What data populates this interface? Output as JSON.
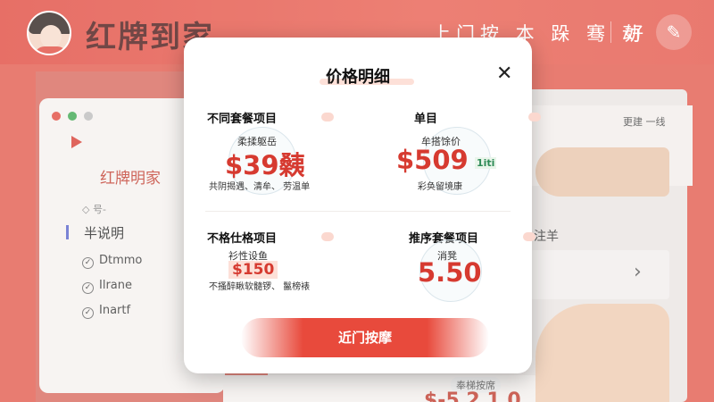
{
  "app": {
    "brand": "红牌到家",
    "nav_label": "上门按 本 跺 骞 动",
    "nav_short": "好"
  },
  "background": {
    "window_brand": "红牌明家",
    "small_text": "◇ 号-",
    "section_title": "半说明",
    "items": [
      "Dtmmo",
      "Ilrane",
      "Inartf"
    ],
    "right_label": "更建 一线",
    "right_text": "注羊",
    "bottom_badge": "奉梯按席",
    "bottom_price": "$-5 2 1 0"
  },
  "modal": {
    "title": "价格明细",
    "close_icon": "close-icon",
    "cells": [
      {
        "label": "不同套餐项目",
        "sub": "柔揉躯岳",
        "price": "$39",
        "price_suffix": "㯩",
        "note": "共阴揭遇、清牟、 劳温单"
      },
      {
        "label": "单目",
        "sub": "牟搭馀价",
        "price": "$509",
        "up_tag": "1iti",
        "note": "彩奂留境康"
      },
      {
        "label": "不格仕格项目",
        "sub": "衫性设鱼",
        "price": "$150",
        "note": "不搔醉瞅软髓锣、 鬣榜裱"
      },
      {
        "label": "推序套餐项目",
        "sub": "消凳",
        "price": "5.50"
      }
    ],
    "cta_label": "近门按摩"
  },
  "colors": {
    "brand_red": "#e0473c",
    "price_red": "#d63a30",
    "accent_green": "#2e8b57"
  }
}
